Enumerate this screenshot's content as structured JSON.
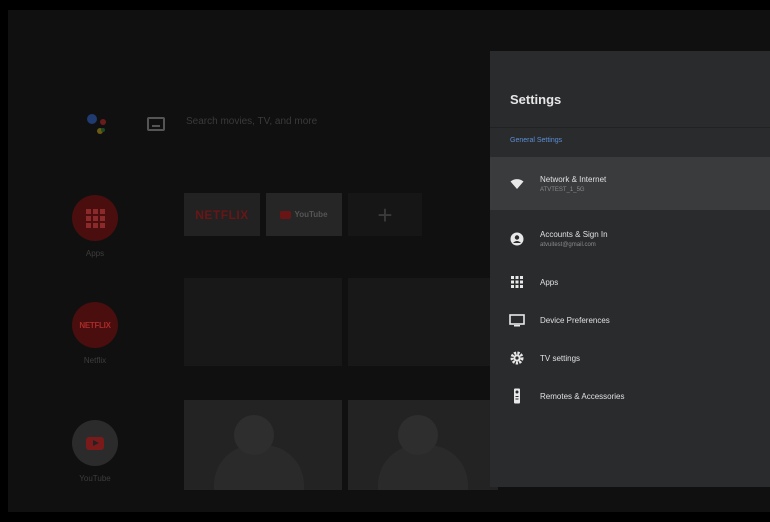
{
  "launcher": {
    "search_placeholder": "Search movies, TV, and more",
    "side_apps": [
      {
        "label": "Apps"
      },
      {
        "label": "Netflix",
        "badge": "NETFLIX"
      },
      {
        "label": "YouTube"
      }
    ],
    "tiles": {
      "netflix": "NETFLIX",
      "youtube": "YouTube",
      "add": "+"
    }
  },
  "settings": {
    "title": "Settings",
    "section": "General Settings",
    "items": [
      {
        "title": "Network & Internet",
        "subtitle": "ATVTEST_1_5G",
        "icon": "wifi-icon"
      },
      {
        "title": "Accounts & Sign In",
        "subtitle": "atvuitest@gmail.com",
        "icon": "account-icon"
      },
      {
        "title": "Apps",
        "icon": "apps-grid-icon"
      },
      {
        "title": "Device Preferences",
        "icon": "monitor-icon"
      },
      {
        "title": "TV settings",
        "icon": "gear-icon"
      },
      {
        "title": "Remotes & Accessories",
        "icon": "remote-icon"
      }
    ]
  },
  "colors": {
    "panel_bg": "#2a2b2d",
    "accent": "#5c8fd6",
    "focused_bg": "#3a3b3d"
  }
}
